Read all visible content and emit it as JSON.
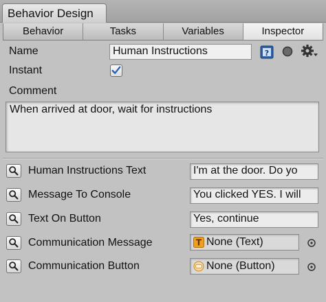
{
  "window": {
    "title": "Behavior Design"
  },
  "tabs": [
    {
      "label": "Behavior",
      "active": false
    },
    {
      "label": "Tasks",
      "active": false
    },
    {
      "label": "Variables",
      "active": false
    },
    {
      "label": "Inspector",
      "active": true
    }
  ],
  "inspector": {
    "name_label": "Name",
    "name_value": "Human Instructions",
    "instant_label": "Instant",
    "instant_checked": true,
    "comment_label": "Comment",
    "comment_value": "When arrived at door, wait for instructions"
  },
  "properties": [
    {
      "label": "Human Instructions Text",
      "value": "I'm at the door. Do yo",
      "kind": "text"
    },
    {
      "label": "Message To Console",
      "value": "You clicked YES. I will",
      "kind": "text"
    },
    {
      "label": "Text On Button",
      "value": "Yes, continue",
      "kind": "text"
    },
    {
      "label": "Communication Message",
      "value": "None (Text)",
      "kind": "object",
      "icon": "text-component-icon"
    },
    {
      "label": "Communication Button",
      "value": "None (Button)",
      "kind": "object",
      "icon": "button-component-icon"
    }
  ],
  "colors": {
    "panel_bg": "#c2c2c2",
    "help_icon_blue": "#2a5fa8",
    "check_blue": "#1f5fb6",
    "text_icon_orange": "#f0a020"
  }
}
